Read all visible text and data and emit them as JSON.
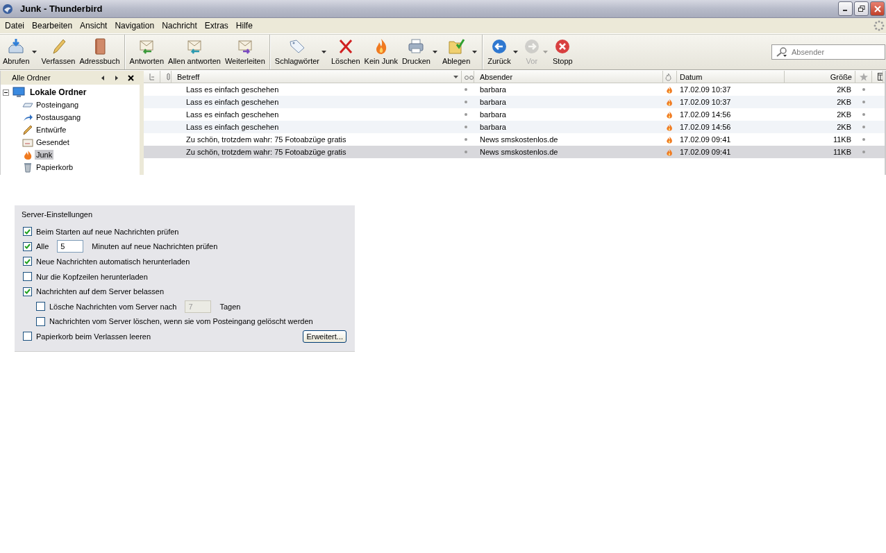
{
  "window": {
    "title": "Junk - Thunderbird"
  },
  "menu": [
    "Datei",
    "Bearbeiten",
    "Ansicht",
    "Navigation",
    "Nachricht",
    "Extras",
    "Hilfe"
  ],
  "toolbar": [
    {
      "label": "Abrufen",
      "dropdown": true,
      "disabled": false,
      "group_end": false
    },
    {
      "label": "Verfassen",
      "dropdown": false,
      "disabled": false,
      "group_end": false
    },
    {
      "label": "Adressbuch",
      "dropdown": false,
      "disabled": false,
      "group_end": true
    },
    {
      "label": "Antworten",
      "dropdown": false,
      "disabled": false,
      "group_end": false
    },
    {
      "label": "Allen antworten",
      "dropdown": false,
      "disabled": false,
      "group_end": false
    },
    {
      "label": "Weiterleiten",
      "dropdown": false,
      "disabled": false,
      "group_end": true
    },
    {
      "label": "Schlagwörter",
      "dropdown": true,
      "disabled": false,
      "group_end": false
    },
    {
      "label": "Löschen",
      "dropdown": false,
      "disabled": false,
      "group_end": false
    },
    {
      "label": "Kein Junk",
      "dropdown": false,
      "disabled": false,
      "group_end": false
    },
    {
      "label": "Drucken",
      "dropdown": true,
      "disabled": false,
      "group_end": false
    },
    {
      "label": "Ablegen",
      "dropdown": true,
      "disabled": false,
      "group_end": true
    },
    {
      "label": "Zurück",
      "dropdown": true,
      "disabled": false,
      "group_end": false
    },
    {
      "label": "Vor",
      "dropdown": true,
      "disabled": true,
      "group_end": false
    },
    {
      "label": "Stopp",
      "dropdown": false,
      "disabled": false,
      "group_end": false
    }
  ],
  "search": {
    "placeholder": "Absender"
  },
  "folder_pane": {
    "title": "Alle Ordner",
    "tree": [
      {
        "label": "Lokale Ordner",
        "expanded": true,
        "selected": false,
        "children": [
          {
            "label": "Posteingang",
            "selected": false
          },
          {
            "label": "Postausgang",
            "selected": false
          },
          {
            "label": "Entwürfe",
            "selected": false
          },
          {
            "label": "Gesendet",
            "selected": false
          },
          {
            "label": "Junk",
            "selected": true
          },
          {
            "label": "Papierkorb",
            "selected": false
          }
        ]
      }
    ]
  },
  "table": {
    "columns": [
      "Betreff",
      "Absender",
      "Datum",
      "Größe"
    ],
    "rows": [
      {
        "subject": "Lass es einfach geschehen",
        "sender": "barbara",
        "date": "17.02.09 10:37",
        "size": "2KB",
        "junk": true,
        "selected": false
      },
      {
        "subject": "Lass es einfach geschehen",
        "sender": "barbara",
        "date": "17.02.09 10:37",
        "size": "2KB",
        "junk": true,
        "selected": false
      },
      {
        "subject": "Lass es einfach geschehen",
        "sender": "barbara",
        "date": "17.02.09 14:56",
        "size": "2KB",
        "junk": true,
        "selected": false
      },
      {
        "subject": "Lass es einfach geschehen",
        "sender": "barbara",
        "date": "17.02.09 14:56",
        "size": "2KB",
        "junk": true,
        "selected": false
      },
      {
        "subject": "Zu schön, trotzdem wahr: 75 Fotoabzüge gratis",
        "sender": "News smskostenlos.de",
        "date": "17.02.09 09:41",
        "size": "11KB",
        "junk": true,
        "selected": false
      },
      {
        "subject": "Zu schön, trotzdem wahr: 75 Fotoabzüge gratis",
        "sender": "News smskostenlos.de",
        "date": "17.02.09 09:41",
        "size": "11KB",
        "junk": true,
        "selected": true
      }
    ]
  },
  "settings": {
    "title": "Server-Einstellungen",
    "items": [
      {
        "kind": "checkbox",
        "label": "Beim Starten auf neue Nachrichten prüfen",
        "checked": true
      },
      {
        "kind": "checkbox-field",
        "label": "Alle",
        "value": "5",
        "after": "Minuten auf neue Nachrichten prüfen",
        "checked": true,
        "disabled": false
      },
      {
        "kind": "checkbox",
        "label": "Neue Nachrichten automatisch herunterladen",
        "checked": true
      },
      {
        "kind": "checkbox",
        "label": "Nur die Kopfzeilen herunterladen",
        "checked": false
      },
      {
        "kind": "checkbox",
        "label": "Nachrichten auf dem Server belassen",
        "checked": true,
        "children": [
          {
            "kind": "checkbox-field",
            "label": "Lösche Nachrichten vom Server nach",
            "value": "7",
            "after": "Tagen",
            "checked": false,
            "disabled": true
          },
          {
            "kind": "checkbox",
            "label": "Nachrichten vom Server löschen, wenn sie vom Posteingang gelöscht werden",
            "checked": false
          }
        ]
      },
      {
        "kind": "checkbox",
        "label": "Papierkorb beim Verlassen leeren",
        "checked": false
      }
    ],
    "button": "Erweitert..."
  }
}
